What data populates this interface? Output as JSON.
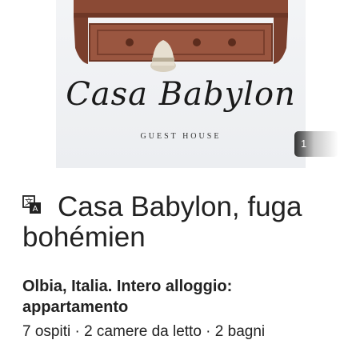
{
  "listing": {
    "photo": {
      "logo_title": "Casa Babylon",
      "logo_subtitle": "GUEST HOUSE",
      "page_indicator": "1"
    },
    "translate_icon": "translate-icon",
    "title": "Casa Babylon, fuga bohémien",
    "location": "Olbia, Italia. Intero alloggio: appartamento",
    "details": "7 ospiti · 2 camere da letto · 2 bagni"
  },
  "colors": {
    "wood": "#8b4a35",
    "text": "#222222",
    "photo_bg": "#eceef1"
  }
}
